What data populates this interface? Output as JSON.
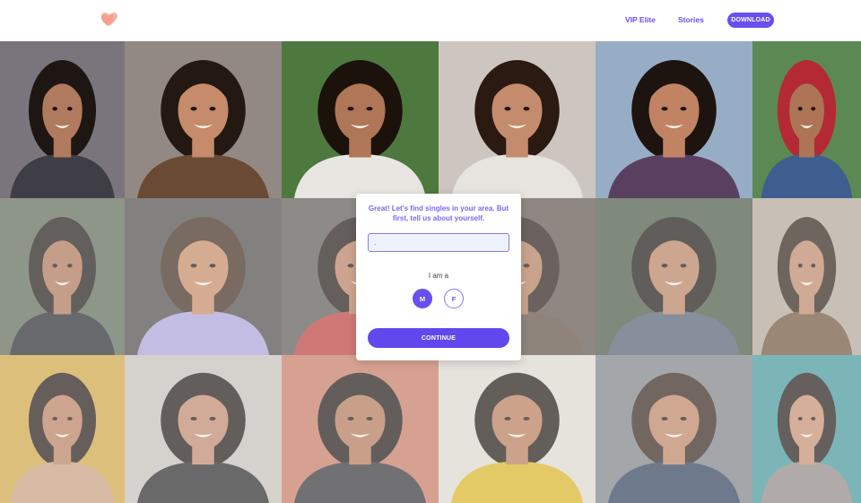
{
  "header": {
    "logo_icon": "heart-logo-icon",
    "nav": [
      {
        "label": "VIP Elite"
      },
      {
        "label": "Stories"
      }
    ],
    "download_label": "DOWNLOAD"
  },
  "colors": {
    "accent": "#6a4ff0",
    "title_text": "#7e66f2",
    "input_bg": "#eef2ff",
    "logo_front": "#f7a08a",
    "logo_back": "#f4b6a8"
  },
  "photo_grid": {
    "tiles": [
      {
        "bg": "#6f6a72",
        "skin": "#b07a5e",
        "hair": "#1e1612",
        "shirt": "#3f3d45"
      },
      {
        "bg": "#8a7f7a",
        "skin": "#c58b6a",
        "hair": "#231812",
        "shirt": "#6a4a35"
      },
      {
        "bg": "#3f6e2e",
        "skin": "#b07658",
        "hair": "#1c120c",
        "shirt": "#e9e6e2"
      },
      {
        "bg": "#c9c2bb",
        "skin": "#c48c6c",
        "hair": "#2a1a12",
        "shirt": "#e7e3df"
      },
      {
        "bg": "#8fa7c0",
        "skin": "#c18363",
        "hair": "#1d140f",
        "shirt": "#5a4060"
      },
      {
        "bg": "#4f7f45",
        "skin": "#ad7555",
        "hair": "#b32a35",
        "shirt": "#3d5e8f"
      },
      {
        "bg": "#4b5845",
        "skin": "#a97052",
        "hair": "#1a1410",
        "shirt": "#202327"
      },
      {
        "bg": "#3a3734",
        "skin": "#c2855f",
        "hair": "#3a2419",
        "shirt": "#a99ed6"
      },
      {
        "bg": "#4a4642",
        "skin": "#b57a5a",
        "hair": "#1d1410",
        "shirt": "#b83a36"
      },
      {
        "bg": "#4c4037",
        "skin": "#b07858",
        "hair": "#241812",
        "shirt": "#5a4a3e"
      },
      {
        "bg": "#34452f",
        "skin": "#b57c5c",
        "hair": "#17110d",
        "shirt": "#4d5a6a"
      },
      {
        "bg": "#a89a8c",
        "skin": "#b88264",
        "hair": "#2b1c14",
        "shirt": "#6b4e36"
      },
      {
        "bg": "#c89a2c",
        "skin": "#b57a58",
        "hair": "#1c130e",
        "shirt": "#c49a78"
      },
      {
        "bg": "#bcb6ae",
        "skin": "#bb8466",
        "hair": "#1a120e",
        "shirt": "#222222"
      },
      {
        "bg": "#c06a52",
        "skin": "#ae7352",
        "hair": "#1a130f",
        "shirt": "#2e2e33"
      },
      {
        "bg": "#d8d2c8",
        "skin": "#b57654",
        "hair": "#1b120d",
        "shirt": "#d6b21e"
      },
      {
        "bg": "#6f7478",
        "skin": "#ba7f5f",
        "hair": "#2e1f16",
        "shirt": "#2a3a55"
      },
      {
        "bg": "#2f8a8c",
        "skin": "#c28a6a",
        "hair": "#1d1511",
        "shirt": "#8b8480"
      }
    ]
  },
  "modal": {
    "title": "Great! Let's find singles in your area. But first, tell us about yourself.",
    "zip_value": ".",
    "iama_label": "I am a",
    "gender_m": "M",
    "gender_f": "F",
    "continue_label": "CONTINUE"
  }
}
